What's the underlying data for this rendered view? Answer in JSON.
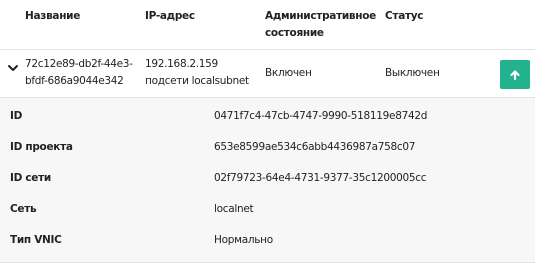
{
  "table": {
    "columns": [
      "Название",
      "IP-адрес",
      "Административное состояние",
      "Статус"
    ]
  },
  "row": {
    "name": "72c12e89-db2f-44e3-bfdf-686a9044e342",
    "ip": "192.168.2.159 подсети localsubnet",
    "admin_state": "Включен",
    "status": "Выключен",
    "expand_icon": "chevron-down-icon",
    "action_icon": "arrow-up-icon"
  },
  "details": [
    {
      "label": "ID",
      "value": "0471f7c4-47cb-4747-9990-518119e8742d"
    },
    {
      "label": "ID проекта",
      "value": "653e8599ae534c6abb4436987a758c07"
    },
    {
      "label": "ID сети",
      "value": "02f79723-64e4-4731-9377-35c1200005cc"
    },
    {
      "label": "Сеть",
      "value": "localnet"
    },
    {
      "label": "Тип VNIC",
      "value": "Нормально"
    }
  ],
  "colors": {
    "accent": "#23b28e",
    "detail_bg": "#f7f7f7",
    "border": "#e3e3e3"
  }
}
